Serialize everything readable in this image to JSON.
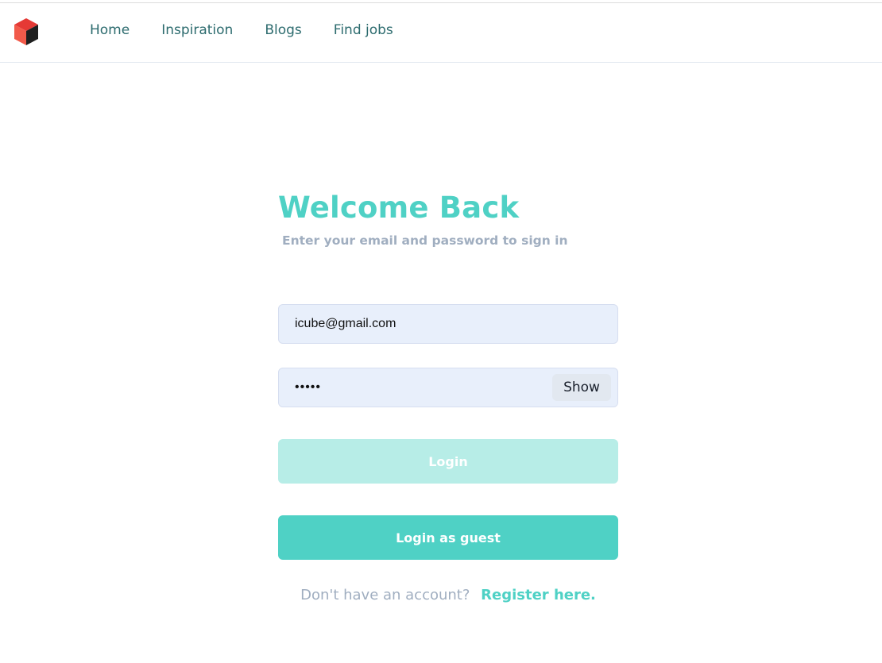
{
  "nav": {
    "logo_icon": "cube-logo-icon",
    "links": [
      "Home",
      "Inspiration",
      "Blogs",
      "Find jobs"
    ]
  },
  "login": {
    "title": "Welcome Back",
    "subtitle": "Enter your email and password to sign in",
    "email_value": "icube@gmail.com",
    "password_value": "•••••",
    "show_label": "Show",
    "login_label": "Login",
    "guest_label": "Login as guest",
    "register_prompt": "Don't have an account?",
    "register_link": "Register here."
  },
  "colors": {
    "accent": "#4fd1c5",
    "accent_light": "#b7ede7",
    "nav_text": "#2c6b6e",
    "muted": "#a0aec0",
    "input_bg": "#e8effb"
  }
}
